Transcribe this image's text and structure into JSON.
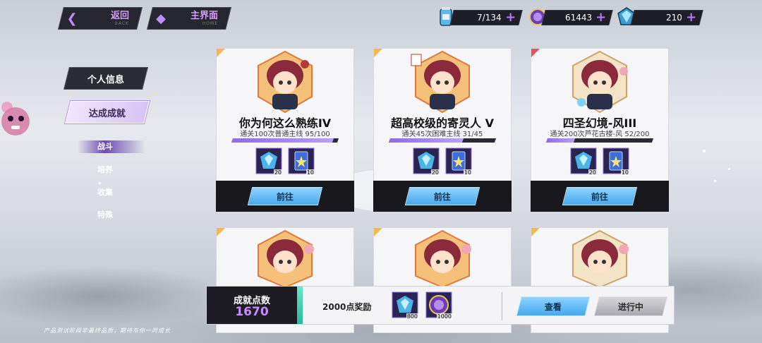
{
  "nav": {
    "back": {
      "label": "返回",
      "sub": "BACK"
    },
    "home": {
      "label": "主界面",
      "sub": "HOME"
    }
  },
  "resources": [
    {
      "icon": "energy-can-icon",
      "value": "7/134"
    },
    {
      "icon": "purple-coin-icon",
      "value": "61443"
    },
    {
      "icon": "cyan-crystal-icon",
      "value": "210"
    }
  ],
  "sidebar": {
    "tabs": [
      {
        "label": "个人信息"
      },
      {
        "label": "达成成就"
      }
    ],
    "subtabs": [
      {
        "label": "战斗"
      },
      {
        "label": "培养"
      },
      {
        "label": "收集"
      },
      {
        "label": "特殊"
      }
    ]
  },
  "achievements": [
    {
      "title": "你为何这么熟练IV",
      "desc": "通关100次普通主线  95/100",
      "progress": 0.95,
      "corner": "#f3b94a",
      "rewards": [
        {
          "icon": "crystal-reward-icon",
          "count": "20"
        },
        {
          "icon": "card-reward-icon",
          "count": "10"
        }
      ],
      "button": "前往"
    },
    {
      "title": "超高校级的寄灵人 V",
      "desc": "通关45次困难主线  31/45",
      "progress": 0.69,
      "corner": "#f3b94a",
      "rewards": [
        {
          "icon": "crystal-reward-icon",
          "count": "20"
        },
        {
          "icon": "card-reward-icon",
          "count": "10"
        }
      ],
      "button": "前往"
    },
    {
      "title": "四圣幻境-风III",
      "desc": "通关200次芦花古楼-风  52/200",
      "progress": 0.26,
      "corner": "#e7505c",
      "rewards": [
        {
          "icon": "crystal-reward-icon",
          "count": "20"
        },
        {
          "icon": "card-reward-icon",
          "count": "10"
        }
      ],
      "button": "前往"
    }
  ],
  "bottom": {
    "points_label": "成就点数",
    "points_value": "1670",
    "bonus_label": "2000点奖励",
    "bonus_rewards": [
      {
        "icon": "crystal-reward-icon",
        "count": "800"
      },
      {
        "icon": "purple-coin-icon",
        "count": "1000"
      }
    ],
    "view_label": "查看",
    "progress_label": "进行中"
  },
  "footer_note": "产品测试阶段非最终品质，期待与你一同成长",
  "colors": {
    "accent": "#b77bff",
    "go_button": "#46a8ee",
    "panel_dark": "#17171c"
  }
}
